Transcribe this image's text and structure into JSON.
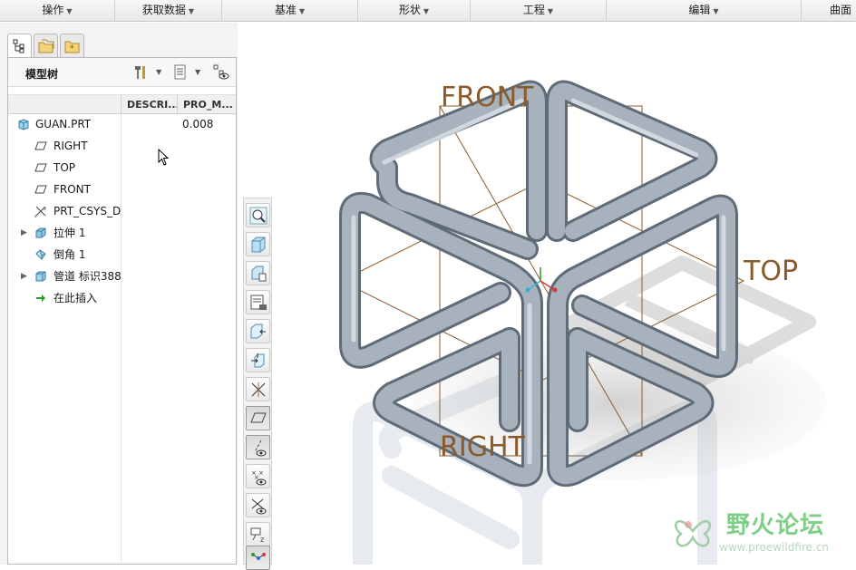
{
  "menubar": {
    "items": [
      {
        "label": "操作"
      },
      {
        "label": "获取数据"
      },
      {
        "label": "基准"
      },
      {
        "label": "形状"
      },
      {
        "label": "工程"
      },
      {
        "label": "编辑"
      },
      {
        "label": "曲面"
      }
    ]
  },
  "model_tree": {
    "title": "模型树",
    "columns": [
      "DESCRI...",
      "PRO_M..."
    ],
    "rows": [
      {
        "label": "GUAN.PRT",
        "icon": "part-icon",
        "value": "0.008"
      },
      {
        "label": "RIGHT",
        "icon": "datum-plane-icon"
      },
      {
        "label": "TOP",
        "icon": "datum-plane-icon"
      },
      {
        "label": "FRONT",
        "icon": "datum-plane-icon"
      },
      {
        "label": "PRT_CSYS_DEF",
        "icon": "csys-icon"
      },
      {
        "label": "拉伸 1",
        "icon": "extrude-icon"
      },
      {
        "label": "倒角 1",
        "icon": "chamfer-icon"
      },
      {
        "label": "管道 标识388",
        "icon": "pipe-icon"
      },
      {
        "label": "在此插入",
        "icon": "insert-here-arrow-icon"
      }
    ]
  },
  "viewport": {
    "datum_labels": {
      "front": "FRONT",
      "top": "TOP",
      "right": "RIGHT"
    },
    "colors": {
      "datum": "#8a5a2b",
      "pipe": "#9aa6b2",
      "background": "#ffffff"
    }
  },
  "watermark": {
    "title": "野火论坛",
    "url": "www.proewildfire.cn"
  }
}
